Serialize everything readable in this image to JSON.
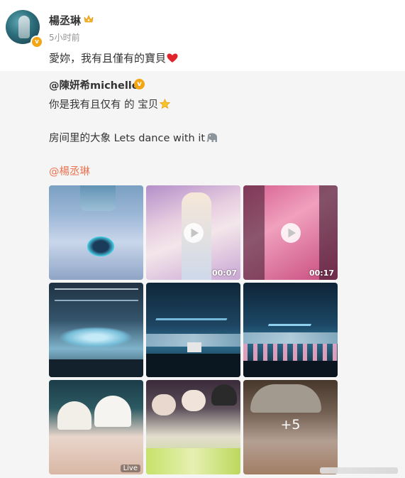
{
  "post": {
    "author": "楊丞琳",
    "time": "5小时前",
    "text": "愛妳，我有且僅有的寶貝"
  },
  "repost": {
    "author": "@陳妍希michelle",
    "line1": "你是我有且仅有 的 宝贝",
    "line2": "房间里的大象 Lets dance with it",
    "mention": "@楊丞琳"
  },
  "media": {
    "items": [
      {
        "kind": "image"
      },
      {
        "kind": "video",
        "duration": "00:07"
      },
      {
        "kind": "video",
        "duration": "00:17"
      },
      {
        "kind": "image"
      },
      {
        "kind": "image"
      },
      {
        "kind": "image"
      },
      {
        "kind": "image",
        "badge": "Live"
      },
      {
        "kind": "image"
      },
      {
        "kind": "image",
        "more": "+5"
      }
    ]
  },
  "colors": {
    "mention": "#eb7350",
    "verified_badge": "#f3a514",
    "background": "#f5f5f5"
  },
  "icons": [
    "crown-icon",
    "verified-icon",
    "heart-icon",
    "star-icon",
    "elephant-icon",
    "play-icon"
  ]
}
